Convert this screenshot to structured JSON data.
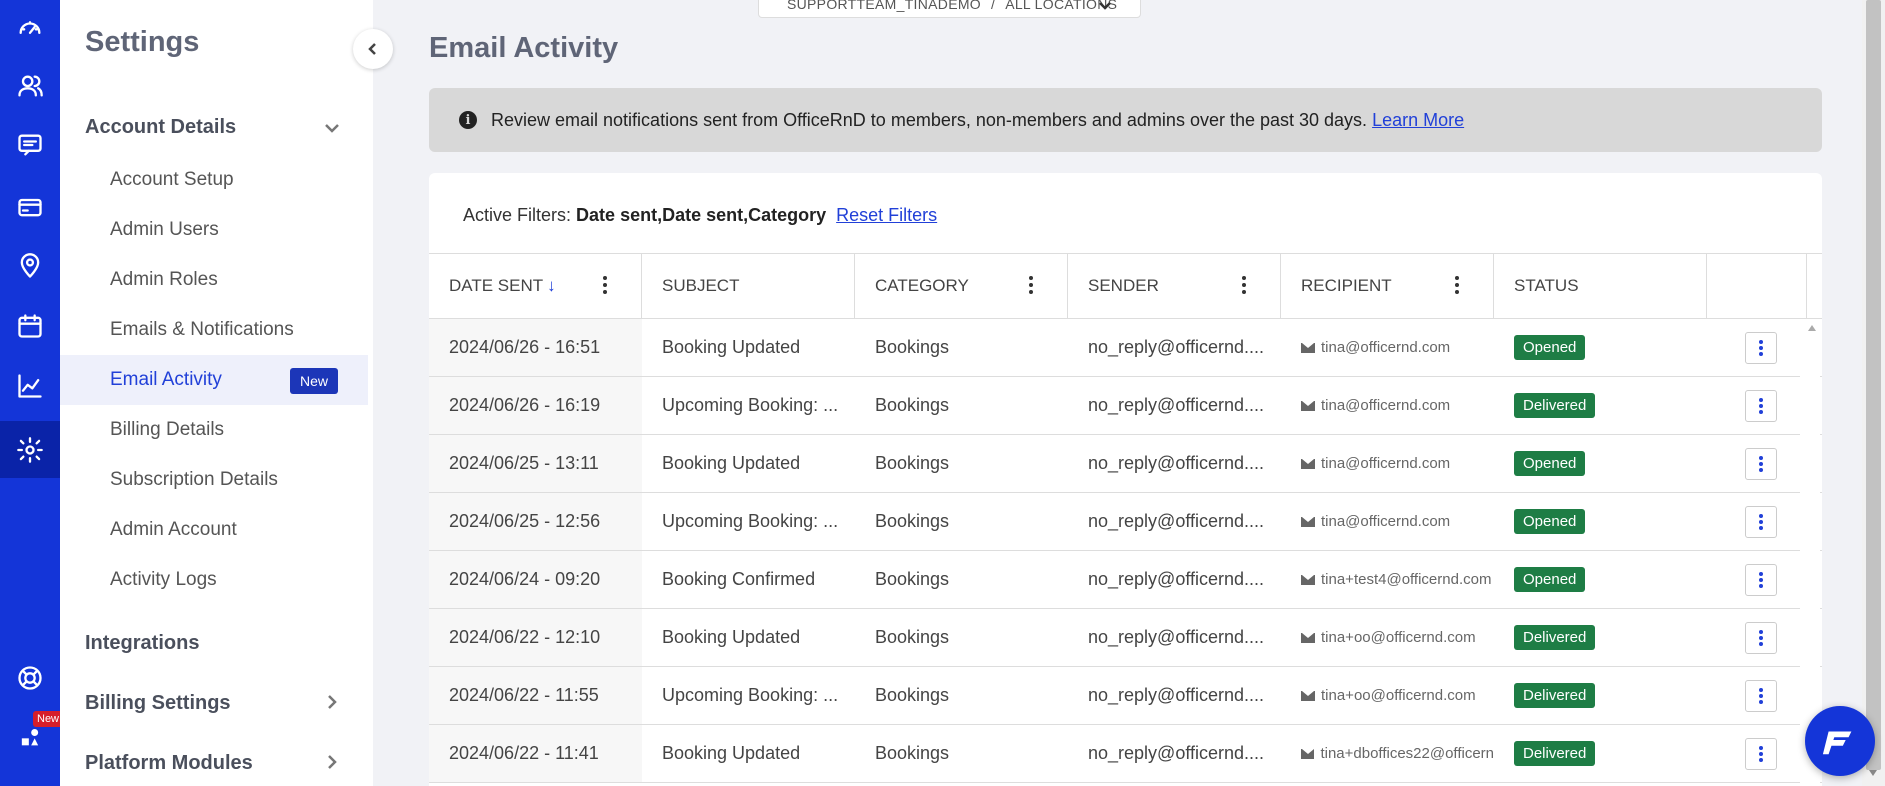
{
  "breadcrumb": {
    "org": "SUPPORTTEAM_TINADEMO",
    "separator": "/",
    "location": "ALL LOCATIONS"
  },
  "rail": {
    "icons": [
      "dashboard-icon",
      "members-icon",
      "chat-icon",
      "billing-card-icon",
      "location-pin-icon",
      "calendar-icon",
      "analytics-icon",
      "settings-icon",
      "help-icon",
      "community-icon"
    ],
    "new_label": "New"
  },
  "sidebar": {
    "title": "Settings",
    "account_details": "Account Details",
    "items": [
      {
        "label": "Account Setup"
      },
      {
        "label": "Admin Users"
      },
      {
        "label": "Admin Roles"
      },
      {
        "label": "Emails & Notifications"
      },
      {
        "label": "Email Activity",
        "badge": "New"
      },
      {
        "label": "Billing Details"
      },
      {
        "label": "Subscription Details"
      },
      {
        "label": "Admin Account"
      },
      {
        "label": "Activity Logs"
      }
    ],
    "integrations": "Integrations",
    "billing_settings": "Billing Settings",
    "platform_modules": "Platform Modules"
  },
  "main": {
    "title": "Email Activity",
    "info_text": "Review email notifications sent from OfficeRnD to members, non-members and admins over the past 30 days.",
    "info_link": "Learn More",
    "filters_label": "Active Filters:",
    "filters_value": "Date sent,Date sent,Category",
    "reset_filters": "Reset Filters"
  },
  "table": {
    "columns": [
      "DATE SENT",
      "SUBJECT",
      "CATEGORY",
      "SENDER",
      "RECIPIENT",
      "STATUS"
    ],
    "rows": [
      {
        "date": "2024/06/26 - 16:51",
        "subject": "Booking Updated",
        "category": "Bookings",
        "sender": "no_reply@officernd....",
        "recipient": "tina@officernd.com",
        "status": "Opened"
      },
      {
        "date": "2024/06/26 - 16:19",
        "subject": "Upcoming Booking: ...",
        "category": "Bookings",
        "sender": "no_reply@officernd....",
        "recipient": "tina@officernd.com",
        "status": "Delivered"
      },
      {
        "date": "2024/06/25 - 13:11",
        "subject": "Booking Updated",
        "category": "Bookings",
        "sender": "no_reply@officernd....",
        "recipient": "tina@officernd.com",
        "status": "Opened"
      },
      {
        "date": "2024/06/25 - 12:56",
        "subject": "Upcoming Booking: ...",
        "category": "Bookings",
        "sender": "no_reply@officernd....",
        "recipient": "tina@officernd.com",
        "status": "Opened"
      },
      {
        "date": "2024/06/24 - 09:20",
        "subject": "Booking Confirmed",
        "category": "Bookings",
        "sender": "no_reply@officernd....",
        "recipient": "tina+test4@officernd.com",
        "status": "Opened"
      },
      {
        "date": "2024/06/22 - 12:10",
        "subject": "Booking Updated",
        "category": "Bookings",
        "sender": "no_reply@officernd....",
        "recipient": "tina+oo@officernd.com",
        "status": "Delivered"
      },
      {
        "date": "2024/06/22 - 11:55",
        "subject": "Upcoming Booking: ...",
        "category": "Bookings",
        "sender": "no_reply@officernd....",
        "recipient": "tina+oo@officernd.com",
        "status": "Delivered"
      },
      {
        "date": "2024/06/22 - 11:41",
        "subject": "Booking Updated",
        "category": "Bookings",
        "sender": "no_reply@officernd....",
        "recipient": "tina+dboffices22@officern",
        "status": "Delivered"
      }
    ]
  },
  "colors": {
    "rail": "#1435d8",
    "accent": "#2140d8",
    "status_green": "#1e7d45"
  }
}
